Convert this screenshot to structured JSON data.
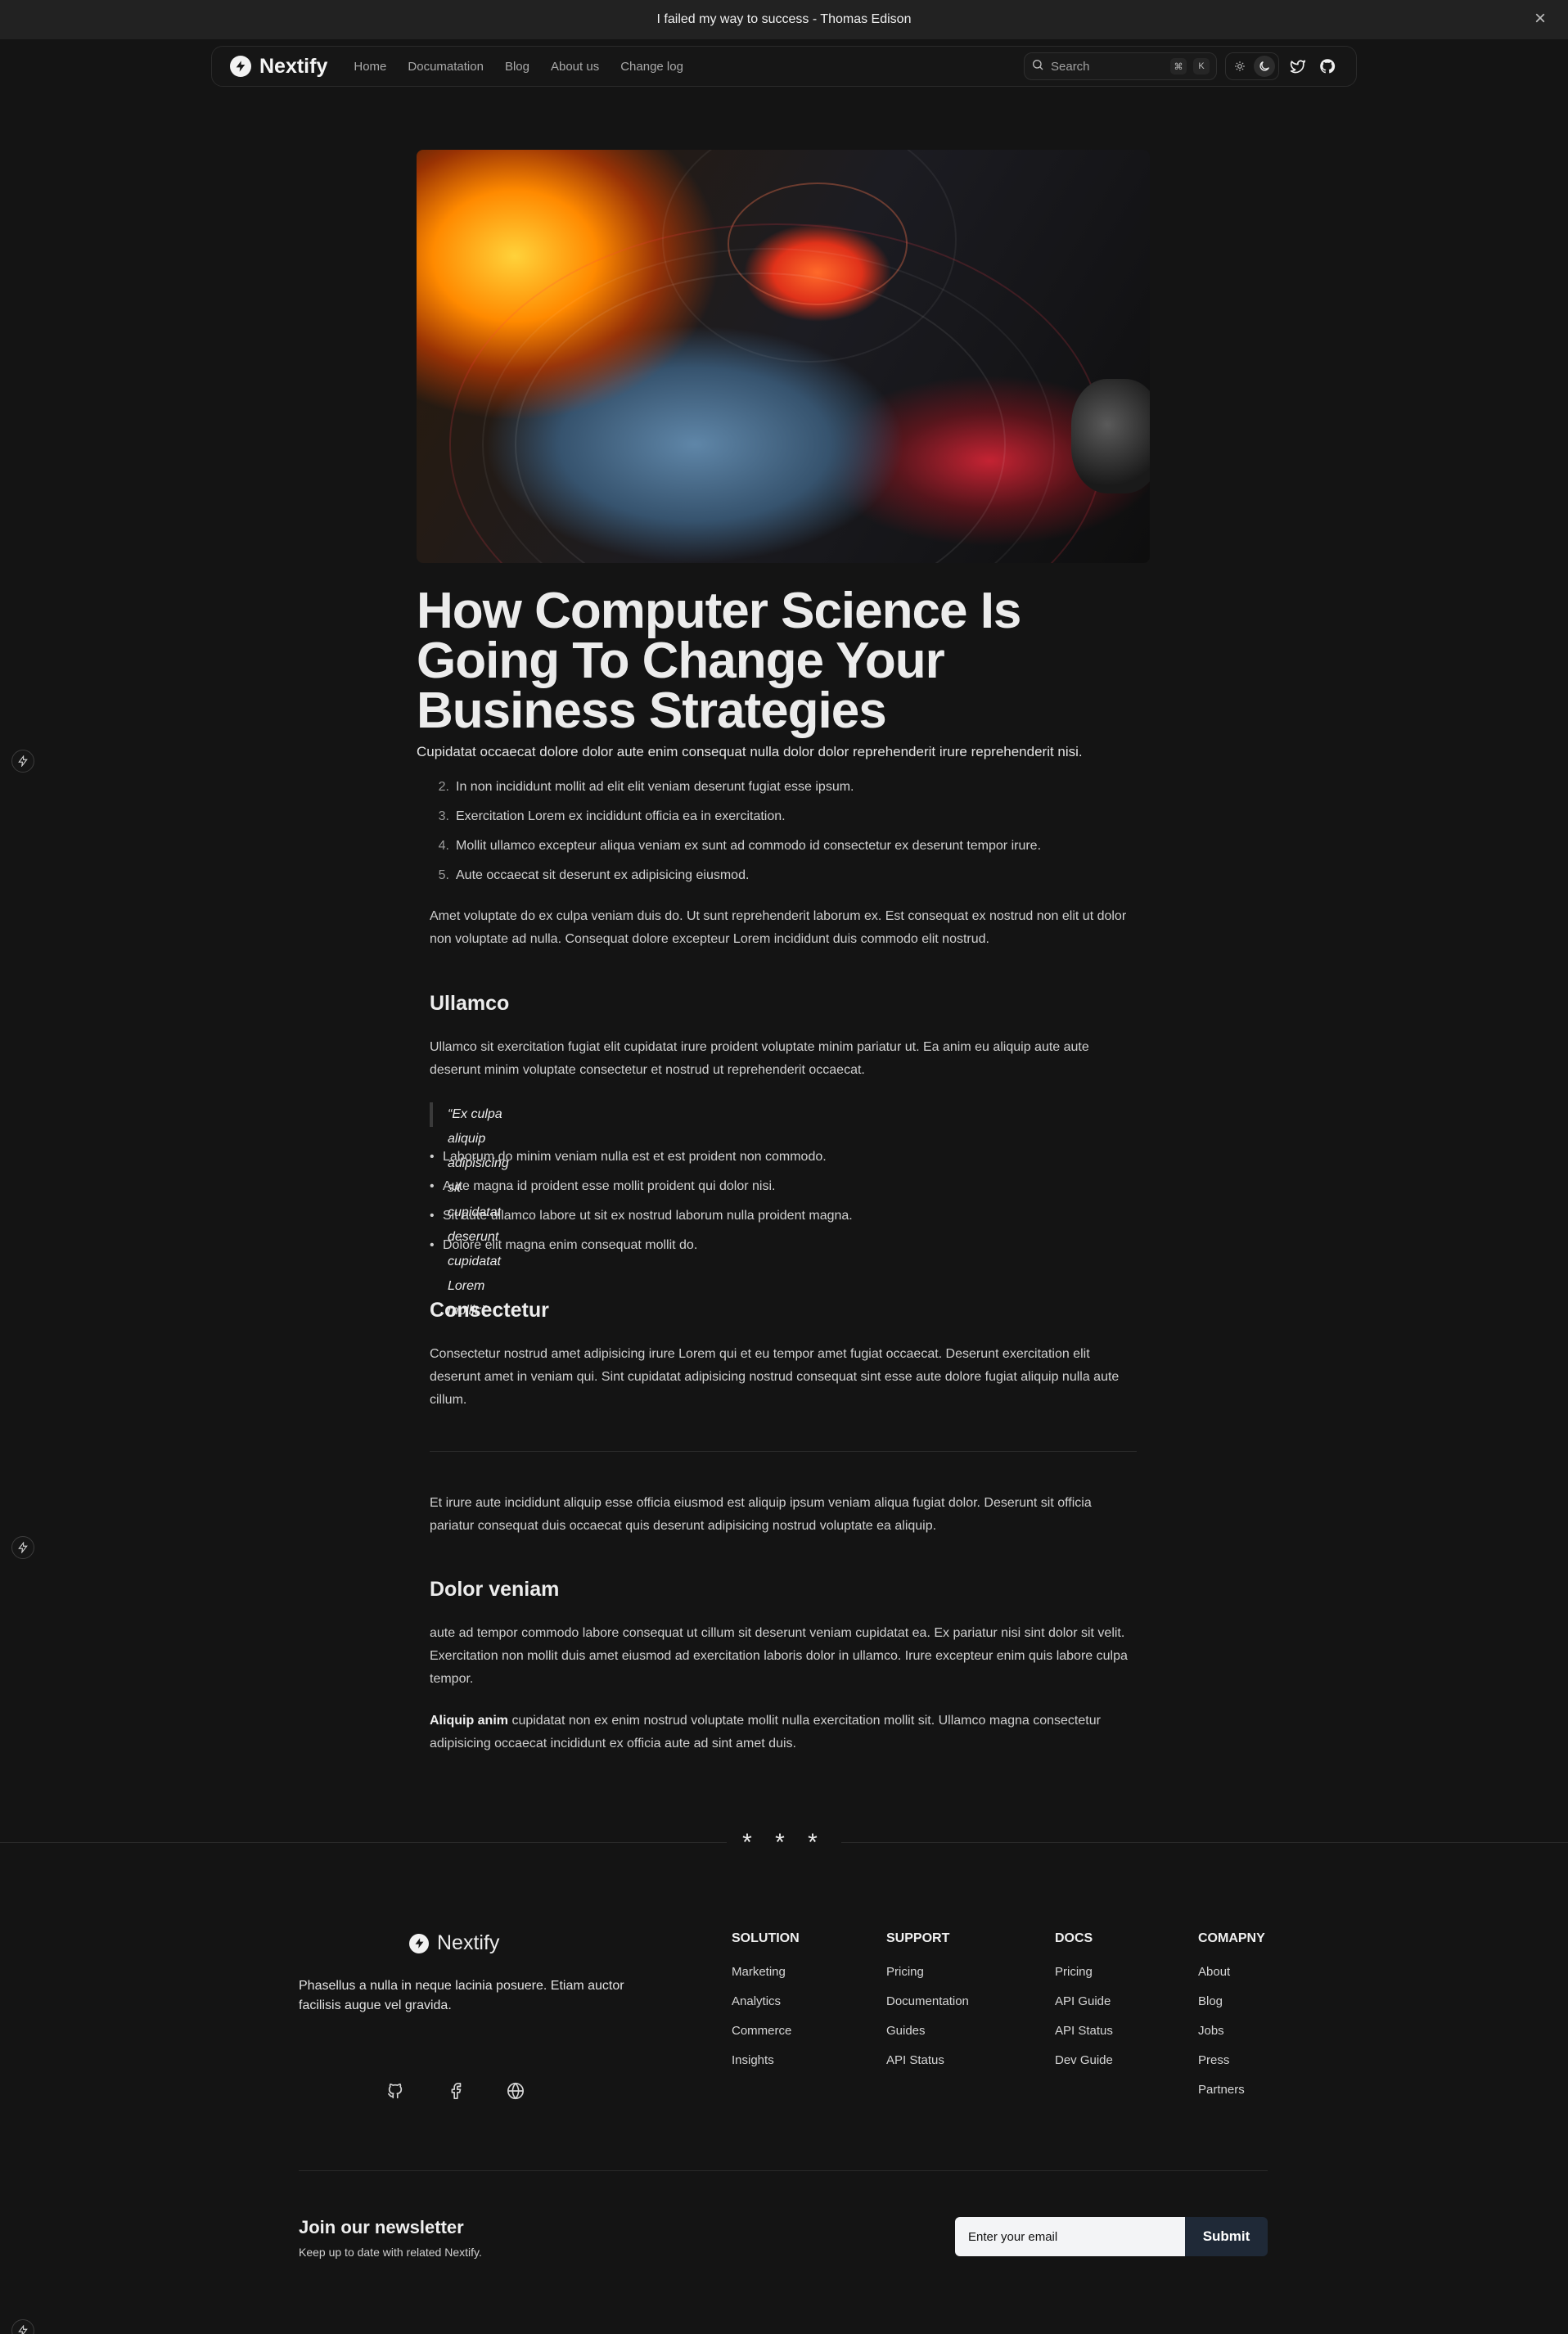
{
  "banner": {
    "text": "I failed my way to success - Thomas Edison",
    "close_icon": "close-icon"
  },
  "nav": {
    "brand": "Nextify",
    "links": [
      "Home",
      "Documatation",
      "Blog",
      "About us",
      "Change log"
    ],
    "search_placeholder": "Search",
    "shortcut_keys": [
      "⌘",
      "K"
    ]
  },
  "article": {
    "title": "How Computer Science Is Going To Change Your Business Strategies",
    "subtitle": "Cupidatat occaecat dolore dolor aute enim consequat nulla dolor dolor reprehenderit irure reprehenderit nisi.",
    "ordered_list": [
      {
        "num": "2.",
        "text": "In non incididunt mollit ad elit elit veniam deserunt fugiat esse ipsum."
      },
      {
        "num": "3.",
        "text": "Exercitation Lorem ex incididunt officia ea in exercitation."
      },
      {
        "num": "4.",
        "text": "Mollit ullamco excepteur aliqua veniam ex sunt ad commodo id consectetur ex deserunt tempor irure."
      },
      {
        "num": "5.",
        "text": "Aute occaecat sit deserunt ex adipisicing eiusmod."
      }
    ],
    "para1": "Amet voluptate do ex culpa veniam duis do. Ut sunt reprehenderit laborum ex. Est consequat ex nostrud non elit ut dolor non voluptate ad nulla. Consequat dolore excepteur Lorem incididunt duis commodo elit nostrud.",
    "h_ullamco": "Ullamco",
    "para2": "Ullamco sit exercitation fugiat elit cupidatat irure proident voluptate minim pariatur ut. Ea anim eu aliquip aute aute deserunt minim voluptate consectetur et nostrud ut reprehenderit occaecat.",
    "quote": "“Ex culpa aliquip adipisicing sit cupidatat deserunt cupidatat Lorem mollit:”",
    "bullets": [
      "Laborum do minim veniam nulla est et est proident non commodo.",
      "Aute magna id proident esse mollit proident qui dolor nisi.",
      "Sit aute ullamco labore ut sit ex nostrud laborum nulla proident magna.",
      "Dolore elit magna enim consequat mollit do."
    ],
    "h_consectetur": "Consectetur",
    "para3": "Consectetur nostrud amet adipisicing irure Lorem qui et eu tempor amet fugiat occaecat. Deserunt exercitation elit deserunt amet in veniam qui. Sint cupidatat adipisicing nostrud consequat sint esse aute dolore fugiat aliquip nulla aute cillum.",
    "para4": "Et irure aute incididunt aliquip esse officia eiusmod est aliquip ipsum veniam aliqua fugiat dolor. Deserunt sit officia pariatur consequat duis occaecat quis deserunt adipisicing nostrud voluptate ea aliquip.",
    "h_dolor": "Dolor veniam",
    "para5": "aute ad tempor commodo labore consequat ut cillum sit deserunt veniam cupidatat ea. Ex pariatur nisi sint dolor sit velit. Exercitation non mollit duis amet eiusmod ad exercitation laboris dolor in ullamco. Irure excepteur enim quis labore culpa tempor.",
    "para6_bold": "Aliquip anim",
    "para6_rest": " cupidatat non ex enim nostrud voluptate mollit nulla exercitation mollit sit. Ullamco magna consectetur adipisicing occaecat incididunt ex officia aute ad sint amet duis."
  },
  "divider": "* * *",
  "footer": {
    "brand": "Nextify",
    "description": "Phasellus a nulla in neque lacinia posuere. Etiam auctor facilisis augue vel gravida.",
    "social_icons": [
      "github-icon",
      "facebook-icon",
      "globe-icon"
    ],
    "columns": [
      {
        "title": "SOLUTION",
        "links": [
          "Marketing",
          "Analytics",
          "Commerce",
          "Insights"
        ]
      },
      {
        "title": "SUPPORT",
        "links": [
          "Pricing",
          "Documentation",
          "Guides",
          "API Status"
        ]
      },
      {
        "title": "DOCS",
        "links": [
          "Pricing",
          "API Guide",
          "API Status",
          "Dev Guide"
        ]
      },
      {
        "title": "COMAPNY",
        "links": [
          "About",
          "Blog",
          "Jobs",
          "Press",
          "Partners"
        ]
      }
    ]
  },
  "newsletter": {
    "title": "Join our newsletter",
    "subtitle": "Keep up to date with related Nextify.",
    "placeholder": "Enter your email",
    "submit": "Submit"
  }
}
